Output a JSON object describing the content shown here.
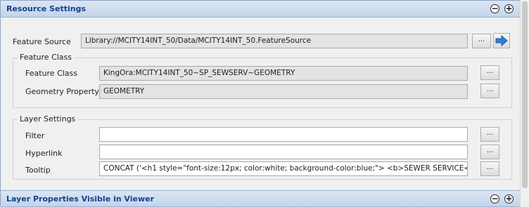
{
  "resource_settings": {
    "title": "Resource Settings",
    "collapse_symbol": "−",
    "expand_symbol": "+"
  },
  "feature_source": {
    "label": "Feature Source",
    "value": "Library://MCITY14INT_50/Data/MCITY14INT_50.FeatureSource",
    "browse_label": "...",
    "go_icon": "arrow-right-icon"
  },
  "feature_class_group": {
    "title": "Feature Class",
    "feature_class": {
      "label": "Feature Class",
      "value": "KingOra:MCITY14INT_50~SP_SEWSERV~GEOMETRY",
      "browse_label": "..."
    },
    "geometry_property": {
      "label": "Geometry Property",
      "value": "GEOMETRY",
      "browse_label": "..."
    }
  },
  "layer_settings_group": {
    "title": "Layer Settings",
    "filter": {
      "label": "Filter",
      "value": "",
      "browse_label": "..."
    },
    "hyperlink": {
      "label": "Hyperlink",
      "value": "",
      "browse_label": "..."
    },
    "tooltip": {
      "label": "Tooltip",
      "value": "CONCAT ('<h1 style=\"font-size:12px; color:white; background-color:blue;\"> <b>SEWER SERVICE<.",
      "browse_label": "..."
    }
  },
  "layer_properties": {
    "title": "Layer Properties Visible in Viewer",
    "collapse_symbol": "−",
    "expand_symbol": "+"
  },
  "colors": {
    "header_text": "#15428b",
    "go_arrow": "#2f7fd6"
  }
}
